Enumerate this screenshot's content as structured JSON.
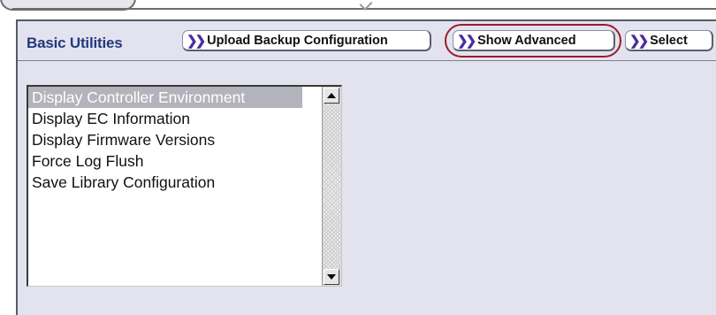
{
  "toolbar": {
    "title": "Basic Utilities",
    "buttons": [
      {
        "label": "Upload Backup Configuration"
      },
      {
        "label": "Show Advanced"
      },
      {
        "label": "Select"
      }
    ]
  },
  "list": {
    "selected_index": 0,
    "items": [
      "Display Controller Environment",
      "Display EC Information",
      "Display Firmware Versions",
      "Force Log Flush",
      "Save Library Configuration"
    ]
  },
  "icons": {
    "button_arrow": "double-chevron-right-icon",
    "scroll_up": "scroll-up-arrow-icon",
    "scroll_down": "scroll-down-arrow-icon"
  },
  "colors": {
    "panel_bg": "#e3e3f0",
    "title_text": "#243a7a",
    "chevron": "#4a2e9e",
    "highlight_ring": "#9b1c2a",
    "selected_item_bg": "#b3b3bc"
  }
}
